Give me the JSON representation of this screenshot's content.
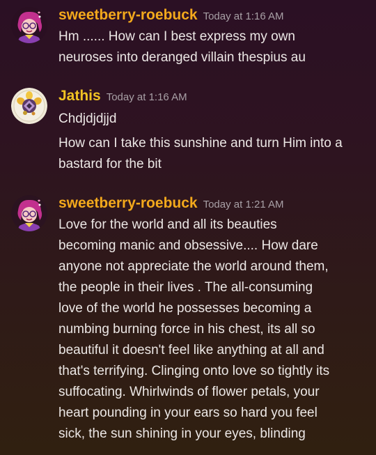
{
  "colors": {
    "sweetberry_name": "#f3a91c",
    "jathis_name": "#f1c323",
    "timestamp": "#a8a0a6",
    "text": "#ece7e5"
  },
  "messages": [
    {
      "avatar_icon": "pink-haired-character-avatar-icon",
      "username": "sweetberry-roebuck",
      "timestamp": "Today at 1:16 AM",
      "lines": [
        "Hm ...... How can I best express my own",
        "neuroses into deranged villain thespius au"
      ]
    },
    {
      "avatar_icon": "round-flower-avatar-icon",
      "username": "Jathis",
      "timestamp": "Today at 1:16 AM",
      "lines": [
        "Chdjdjdjjd",
        "How can I take this sunshine and turn Him into a",
        "bastard for the bit"
      ]
    },
    {
      "avatar_icon": "pink-haired-character-avatar-icon",
      "username": "sweetberry-roebuck",
      "timestamp": "Today at 1:21 AM",
      "lines": [
        "Love for the world and all its beauties",
        "becoming manic and obsessive.... How dare",
        "anyone not appreciate the world around them,",
        "the people in their lives . The all-consuming",
        "love of the world he possesses becoming a",
        "numbing burning force in his chest, its all so",
        "beautiful it doesn't feel like anything at all and",
        "that's terrifying. Clinging onto love so tightly its",
        "suffocating. Whirlwinds of flower petals, your",
        "heart pounding in your ears so hard you feel",
        "sick, the sun shining in your eyes, blinding"
      ]
    }
  ]
}
